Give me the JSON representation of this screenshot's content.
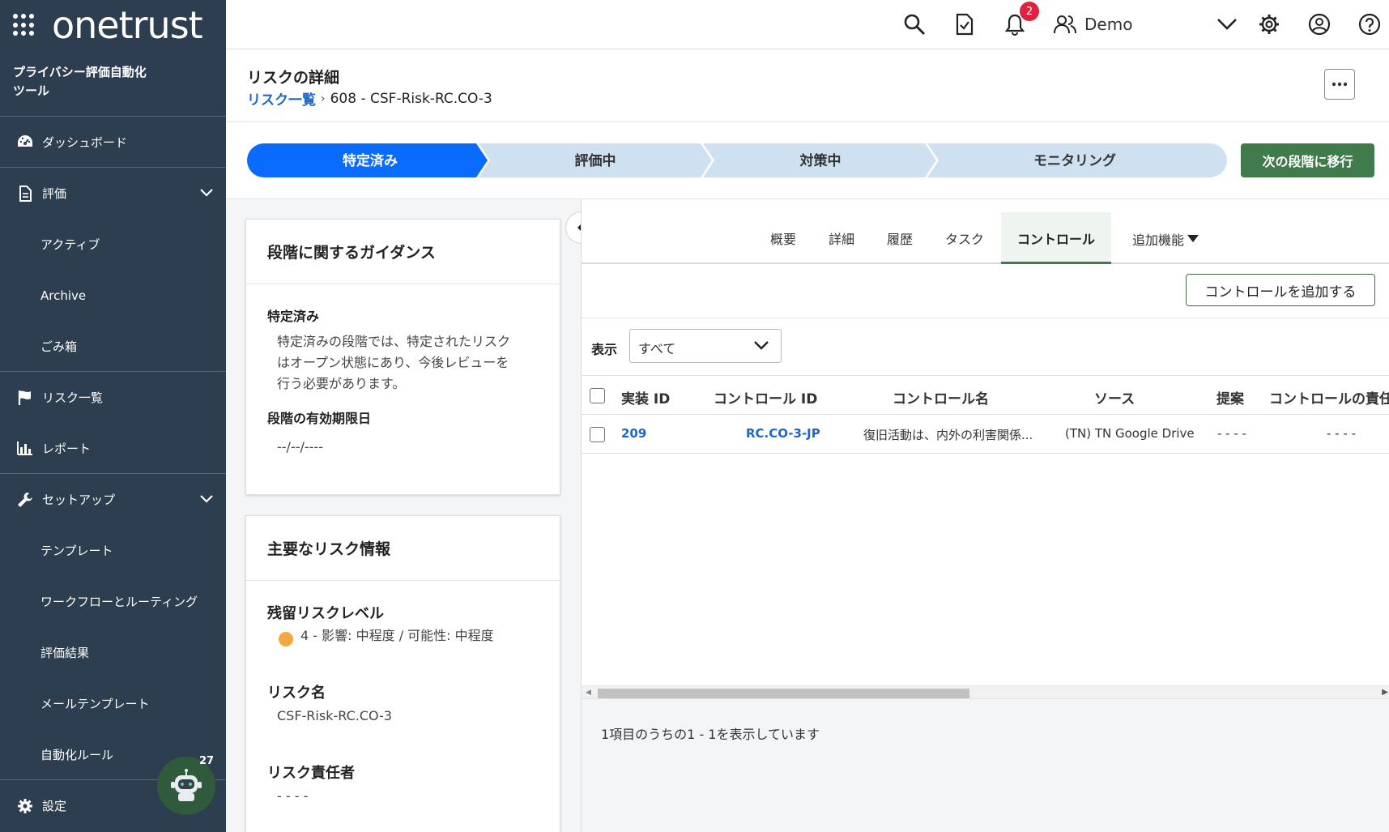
{
  "brand": {
    "logo_text": "onetrust",
    "product_name_line1": "プライバシー評価自動化",
    "product_name_line2": "ツール"
  },
  "sidebar": {
    "items": [
      {
        "label": "ダッシュボード",
        "icon": "dashboard-icon"
      },
      {
        "label": "評価",
        "icon": "document-icon",
        "expanded": true
      },
      {
        "label": "アクティブ"
      },
      {
        "label": "Archive"
      },
      {
        "label": "ごみ箱"
      },
      {
        "label": "リスク一覧",
        "icon": "flag-icon"
      },
      {
        "label": "レポート",
        "icon": "bar-chart-icon"
      },
      {
        "label": "セットアップ",
        "icon": "wrench-icon",
        "expanded": true
      },
      {
        "label": "テンプレート"
      },
      {
        "label": "ワークフローとルーティング"
      },
      {
        "label": "評価結果"
      },
      {
        "label": "メールテンプレート"
      },
      {
        "label": "自動化ルール"
      },
      {
        "label": "設定",
        "icon": "gear-icon"
      }
    ],
    "assistant_badge": "27"
  },
  "topbar": {
    "notification_count": "2",
    "user_name": "Demo"
  },
  "header": {
    "title": "リスクの詳細",
    "breadcrumb_link": "リスク一覧",
    "breadcrumb_current": "608 - CSF-Risk-RC.CO-3"
  },
  "stages": {
    "items": [
      "特定済み",
      "評価中",
      "対策中",
      "モニタリング"
    ],
    "active_index": 0,
    "next_button": "次の段階に移行",
    "colors": {
      "active": "#0a6cff",
      "inactive": "#cfe0f1",
      "next": "#3f7b4b"
    }
  },
  "guidance": {
    "title": "段階に関するガイダンス",
    "stage_label": "特定済み",
    "stage_text_line1": "特定済みの段階では、特定されたリスク",
    "stage_text_line2": "はオープン状態にあり、今後レビューを",
    "stage_text_line3": "行う必要があります。",
    "deadline_label": "段階の有効期限日",
    "deadline_value": "--/--/----"
  },
  "risk_info": {
    "title": "主要なリスク情報",
    "residual_label": "残留リスクレベル",
    "residual_value": "4 - 影響: 中程度 / 可能性: 中程度",
    "residual_color": "#f5a742",
    "name_label": "リスク名",
    "name_value": "CSF-Risk-RC.CO-3",
    "owner_label": "リスク責任者",
    "owner_value": "- - - -"
  },
  "tabs": {
    "items": [
      "概要",
      "詳細",
      "履歴",
      "タスク",
      "コントロール"
    ],
    "more": "追加機能",
    "active": "コントロール"
  },
  "controls": {
    "add_button": "コントロールを追加する",
    "filter_label": "表示",
    "filter_value": "すべて",
    "columns": [
      "実装 ID",
      "コントロール ID",
      "コントロール名",
      "ソース",
      "提案",
      "コントロールの責任"
    ],
    "rows": [
      {
        "impl_id": "209",
        "control_id": "RC.CO-3-JP",
        "control_name": "復旧活動は、内外の利害関係...",
        "source": "(TN) TN Google Drive",
        "proposal": "- - - -",
        "owner": "- - - -"
      }
    ],
    "pager_text": "1項目のうちの1 - 1を表示しています"
  }
}
